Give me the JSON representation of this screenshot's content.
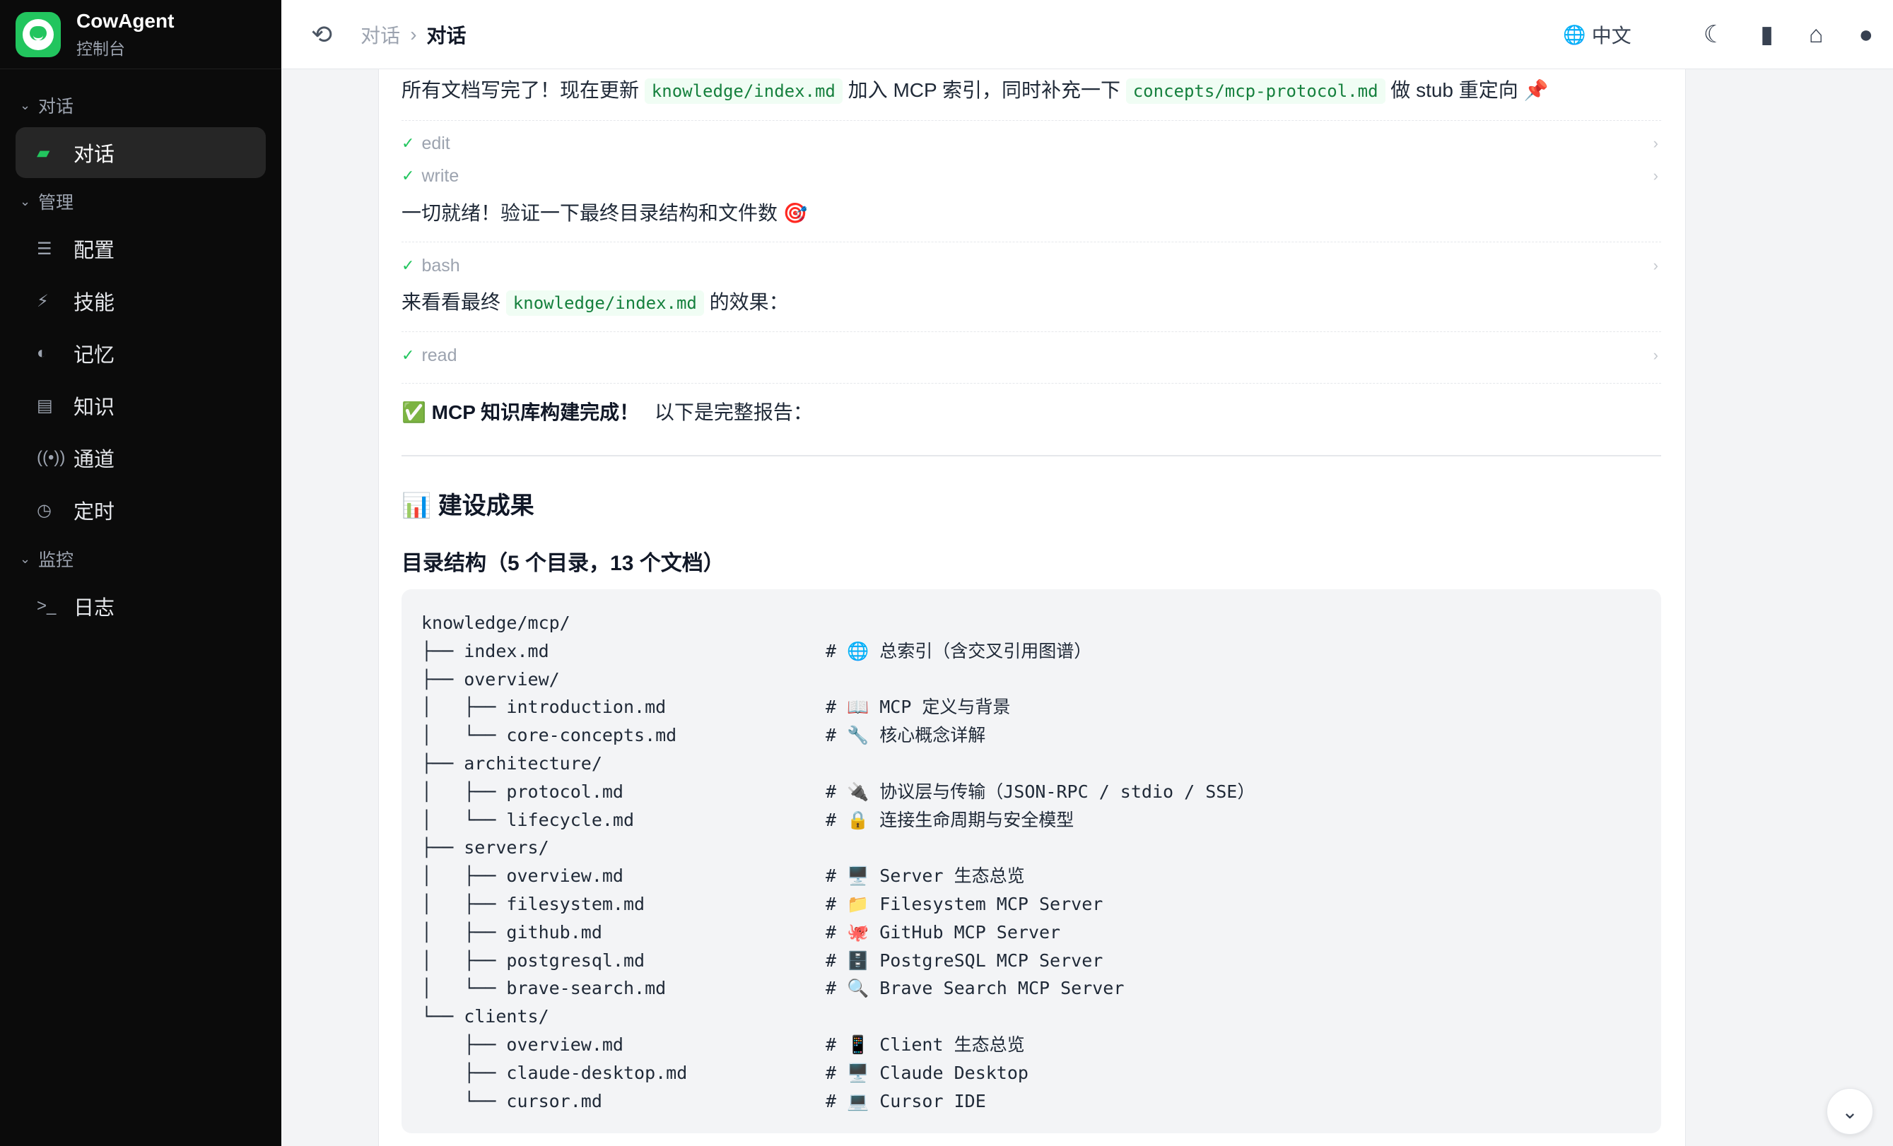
{
  "app": {
    "name": "CowAgent",
    "subtitle": "控制台"
  },
  "sidebar": {
    "sections": [
      {
        "label": "对话",
        "items": [
          {
            "label": "对话",
            "icon": "chat-icon",
            "active": true
          }
        ]
      },
      {
        "label": "管理",
        "items": [
          {
            "label": "配置",
            "icon": "sliders-icon"
          },
          {
            "label": "技能",
            "icon": "bolt-icon"
          },
          {
            "label": "记忆",
            "icon": "brain-icon"
          },
          {
            "label": "知识",
            "icon": "book-icon"
          },
          {
            "label": "通道",
            "icon": "antenna-icon"
          },
          {
            "label": "定时",
            "icon": "clock-icon"
          }
        ]
      },
      {
        "label": "监控",
        "items": [
          {
            "label": "日志",
            "icon": "terminal-icon"
          }
        ]
      }
    ]
  },
  "topbar": {
    "breadcrumb": {
      "parent": "对话",
      "current": "对话"
    },
    "language": "中文",
    "icons": [
      "history-icon",
      "globe-icon",
      "moon-icon",
      "docs-icon",
      "home-icon",
      "github-icon"
    ]
  },
  "messages": {
    "m1": {
      "pre": "所有文档写完了！现在更新",
      "code1": "knowledge/index.md",
      "mid": "加入 MCP 索引，同时补充一下",
      "code2": "concepts/mcp-protocol.md",
      "post": "做 stub 重定向 📌"
    },
    "tool_edit": "edit",
    "tool_write": "write",
    "m2": "一切就绪！验证一下最终目录结构和文件数 🎯",
    "tool_bash": "bash",
    "m3": {
      "pre": "来看看最终",
      "code": "knowledge/index.md",
      "post": "的效果："
    },
    "tool_read": "read",
    "m4": {
      "strong": "✅ MCP 知识库构建完成！",
      "rest": "以下是完整报告："
    },
    "heading": "📊 建设成果",
    "subheading": "目录结构（5 个目录，13 个文档）",
    "code_block": "knowledge/mcp/\n├── index.md                          # 🌐 总索引（含交叉引用图谱）\n├── overview/\n│   ├── introduction.md               # 📖 MCP 定义与背景\n│   └── core-concepts.md              # 🔧 核心概念详解\n├── architecture/\n│   ├── protocol.md                   # 🔌 协议层与传输（JSON-RPC / stdio / SSE）\n│   └── lifecycle.md                  # 🔒 连接生命周期与安全模型\n├── servers/\n│   ├── overview.md                   # 🖥️ Server 生态总览\n│   ├── filesystem.md                 # 📁 Filesystem MCP Server\n│   ├── github.md                     # 🐙 GitHub MCP Server\n│   ├── postgresql.md                 # 🗄️ PostgreSQL MCP Server\n│   └── brave-search.md               # 🔍 Brave Search MCP Server\n└── clients/\n    ├── overview.md                   # 📱 Client 生态总览\n    ├── claude-desktop.md             # 🖥️ Claude Desktop\n    └── cursor.md                     # 💻 Cursor IDE"
  },
  "colors": {
    "accent": "#22c55e",
    "sidebar_bg": "#0b0b0b",
    "code_fg": "#15803d"
  }
}
